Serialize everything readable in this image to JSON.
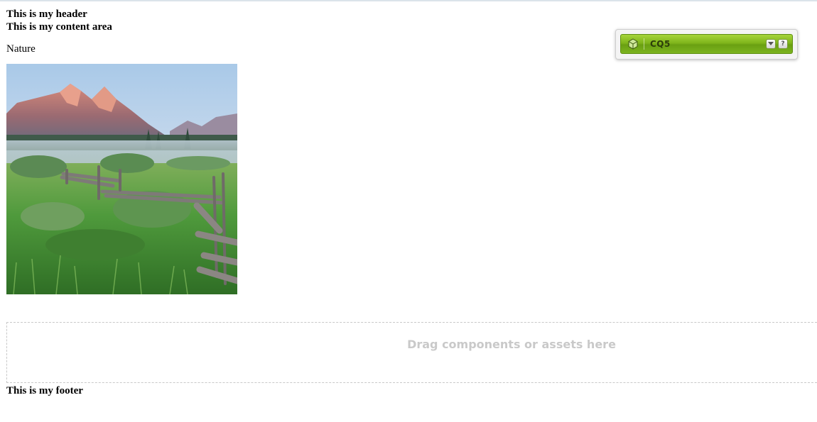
{
  "page": {
    "header": "This is my header",
    "content_title": "This is my content area",
    "paragraph": "Nature",
    "image_subject": "mountain-meadow-fence",
    "dropzone_label": "Drag components or assets here",
    "footer": "This is my footer"
  },
  "sidekick": {
    "title": "CQ5",
    "logo_icon": "cube-icon",
    "menu_icon": "chevron-down-icon",
    "help_label": "?",
    "accent": "#7fb51b"
  }
}
